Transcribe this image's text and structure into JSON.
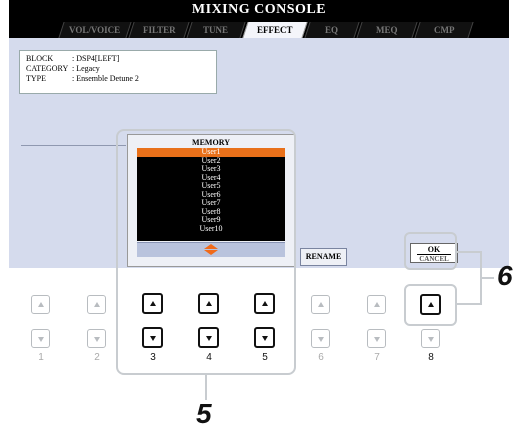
{
  "screen": {
    "title": "MIXING CONSOLE",
    "tabs": [
      "VOL/VOICE",
      "FILTER",
      "TUNE",
      "EFFECT",
      "EQ",
      "MEQ",
      "CMP"
    ],
    "active_tab": "EFFECT",
    "info": [
      {
        "key": "BLOCK",
        "value": ": DSP4[LEFT]"
      },
      {
        "key": "CATEGORY",
        "value": ": Legacy"
      },
      {
        "key": "TYPE",
        "value": ": Ensemble Detune 2"
      }
    ],
    "memory": {
      "title": "MEMORY",
      "items": [
        "User1",
        "User2",
        "User3",
        "User4",
        "User5",
        "User6",
        "User7",
        "User8",
        "User9",
        "User10"
      ],
      "selected": "User1"
    },
    "rename_label": "RENAME",
    "ok_label": "OK",
    "cancel_label": "CANCEL"
  },
  "panel_buttons": [
    "1",
    "2",
    "3",
    "4",
    "5",
    "6",
    "7",
    "8"
  ],
  "highlighted_buttons": [
    "3",
    "4",
    "5",
    "8"
  ],
  "step_labels": {
    "memory_step": "5",
    "ok_step": "6"
  },
  "colors": {
    "selection": "#e8701a",
    "panel": "#d5dbed",
    "titlebar": "#000000"
  }
}
